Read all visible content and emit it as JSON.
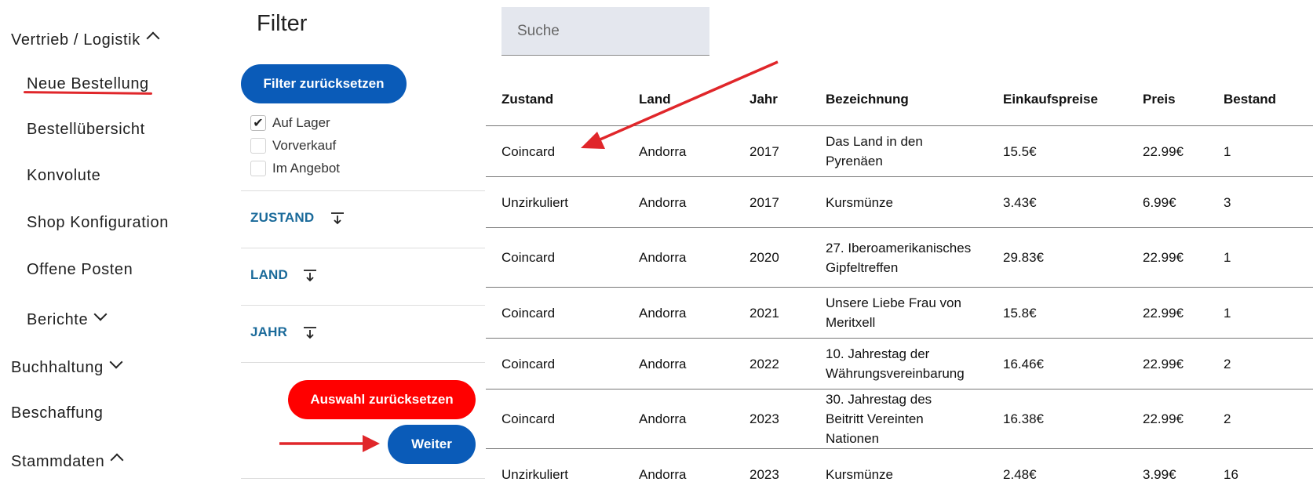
{
  "sidebar": {
    "vertrieb": "Vertrieb / Logistik",
    "neue_bestellung": "Neue Bestellung",
    "bestelluebersicht": "Bestellübersicht",
    "konvolute": "Konvolute",
    "shop_konfiguration": "Shop Konfiguration",
    "offene_posten": "Offene Posten",
    "berichte": "Berichte",
    "buchhaltung": "Buchhaltung",
    "beschaffung": "Beschaffung",
    "stammdaten": "Stammdaten"
  },
  "filter": {
    "title": "Filter",
    "reset_button": "Filter zurücksetzen",
    "checkboxes": [
      {
        "label": "Auf Lager",
        "checked": true
      },
      {
        "label": "Vorverkauf",
        "checked": false
      },
      {
        "label": "Im Angebot",
        "checked": false
      }
    ],
    "sections": [
      "ZUSTAND",
      "LAND",
      "JAHR"
    ],
    "auswahl_reset": "Auswahl zurücksetzen",
    "weiter": "Weiter"
  },
  "search": {
    "placeholder": "Suche"
  },
  "table": {
    "headers": [
      "Zustand",
      "Land",
      "Jahr",
      "Bezeichnung",
      "Einkaufspreise",
      "Preis",
      "Bestand"
    ],
    "rows": [
      [
        "Coincard",
        "Andorra",
        "2017",
        "Das Land in den Pyrenäen",
        "15.5€",
        "22.99€",
        "1"
      ],
      [
        "Unzirkuliert",
        "Andorra",
        "2017",
        "Kursmünze",
        "3.43€",
        "6.99€",
        "3"
      ],
      [
        "Coincard",
        "Andorra",
        "2020",
        "27. Iberoamerikanisches Gipfeltreffen",
        "29.83€",
        "22.99€",
        "1"
      ],
      [
        "Coincard",
        "Andorra",
        "2021",
        "Unsere Liebe Frau von Meritxell",
        "15.8€",
        "22.99€",
        "1"
      ],
      [
        "Coincard",
        "Andorra",
        "2022",
        "10. Jahrestag der Währungsvereinbarung",
        "16.46€",
        "22.99€",
        "2"
      ],
      [
        "Coincard",
        "Andorra",
        "2023",
        "30. Jahrestag des Beitritt Vereinten Nationen",
        "16.38€",
        "22.99€",
        "2"
      ],
      [
        "Unzirkuliert",
        "Andorra",
        "2023",
        "Kursmünze",
        "2.48€",
        "3.99€",
        "16"
      ]
    ]
  },
  "annotation_color": "#e0262a"
}
